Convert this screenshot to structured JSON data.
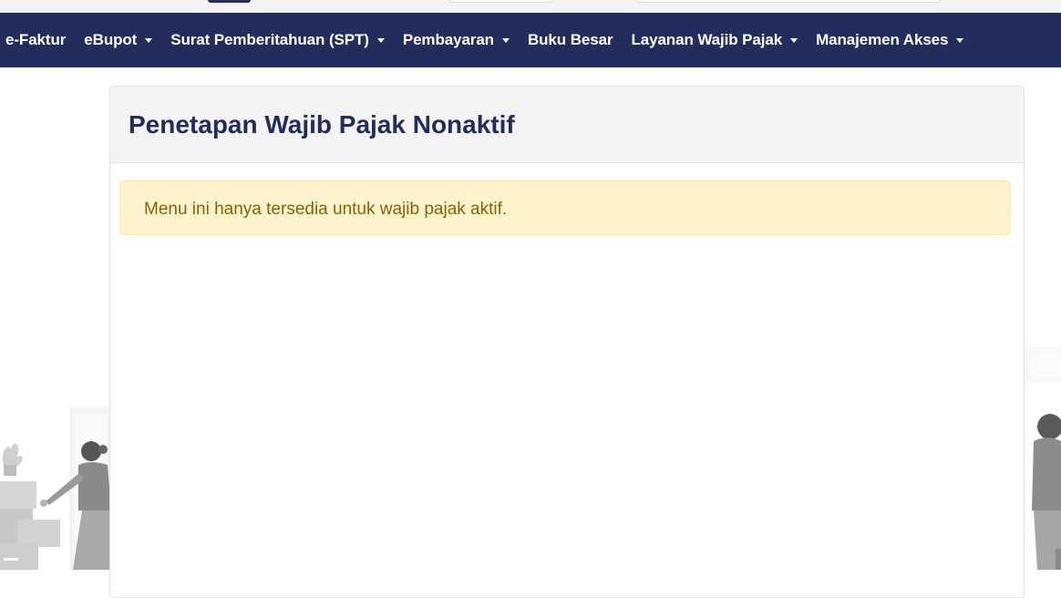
{
  "nav": {
    "items": [
      {
        "label": "e-Faktur",
        "has_dropdown": false
      },
      {
        "label": "eBupot",
        "has_dropdown": true
      },
      {
        "label": "Surat Pemberitahuan (SPT)",
        "has_dropdown": true
      },
      {
        "label": "Pembayaran",
        "has_dropdown": true
      },
      {
        "label": "Buku Besar",
        "has_dropdown": false
      },
      {
        "label": "Layanan Wajib Pajak",
        "has_dropdown": true
      },
      {
        "label": "Manajemen Akses",
        "has_dropdown": true
      }
    ]
  },
  "page": {
    "title": "Penetapan Wajib Pajak Nonaktif",
    "alert_message": "Menu ini hanya tersedia untuk wajib pajak aktif."
  },
  "colors": {
    "navbar": "#222d5e",
    "title": "#222d5e",
    "alert_bg": "#fff3cd",
    "alert_text": "#856404"
  },
  "icons": [
    "chevron-down-icon"
  ]
}
